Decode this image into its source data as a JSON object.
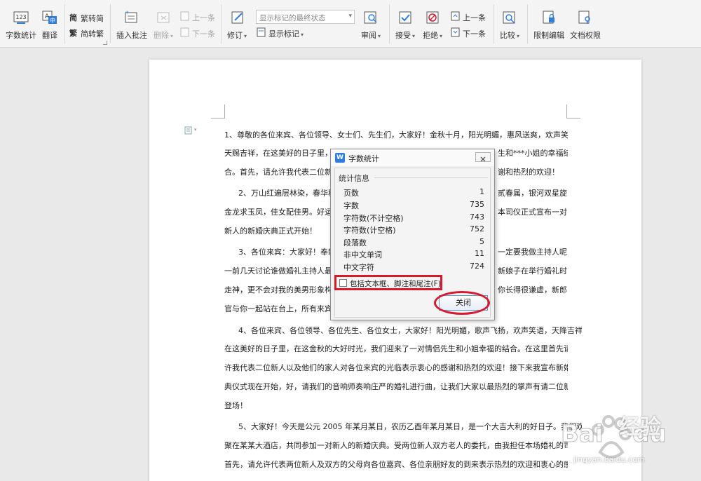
{
  "ribbon": {
    "word_count_label": "字数统计",
    "translate_label": "翻译",
    "trad_to_simp_label": "繁转简",
    "simp_to_trad_label": "简转繁",
    "insert_comment_label": "插入批注",
    "delete_label": "删除",
    "prev_comment_label": "上一条",
    "next_comment_label": "下一条",
    "revise_label": "修订",
    "markup_state_value": "显示标记的最终状态",
    "show_markup_label": "显示标记",
    "review_label": "审阅",
    "accept_label": "接受",
    "reject_label": "拒绝",
    "prev_change_label": "上一条",
    "next_change_label": "下一条",
    "compare_label": "比较",
    "restrict_edit_label": "限制编辑",
    "doc_rights_label": "文档权限"
  },
  "document": {
    "lines": [
      "1、尊敬的各位来宾、各位领导、女士们、先生们，大家好！金秋十月，阳光明媚，惠风送爽，欢声笑语，",
      "天赐吉祥，在这美好的日子里，",
      "合。首先，请允许我代表二位新",
      "2、万山红遍层林染，春华秋",
      "金龙求玉凤，佳女配佳男。好运",
      "新人的新婚庆典正式开始！",
      "3、各位来宾：大家好！奉新",
      "一前几天讨论谁做婚礼主持人最",
      "走神，更不会对我的美男形象构",
      "官与你一起站在台上，所有来宾",
      "4、各位来宾、各位领导、各位先生、各位女士，大家好！阳光明媚，歌声飞扬，欢声笑语，天降吉祥，",
      "在这美好的日子里，在这金秋的大好时光，我们迎来了一对情侣先生和小姐幸福的结合。在这里首先请允",
      "许我代表二位新人以及他们的家人对各位来宾的光临表示衷心的感谢和热烈的欢迎！接下来我宣布新婚庆",
      "典仪式现在开始，好，请我们的音响师奏响庄严的婚礼进行曲，让我们大家以最热烈的掌声有请二位新人",
      "登场！",
      "5、大家好！今天是公元 2005 年某月某日，农历乙酉年某月某日，是一个大吉大利的好日子。我们欢",
      "聚在某某大酒店，共同参加一对新人的新婚庆典。受两位新人双方老人的委托，由我担任本场婚礼的司仪，",
      "首先，请允许代表两位新人及双方的父母向各位嘉宾、各位亲朋好友的到来表示热烈的欢迎和衷心的感谢！"
    ],
    "right_fragments": [
      "生和***小姐的幸福结",
      "谢和热烈的欢迎！",
      "贰春属，银河双星旋，",
      "本司仪正式宣布一对",
      "一定要我做主持人呢",
      "新娘子在举行婚礼时",
      "你长得很谦虚，新郎"
    ]
  },
  "dialog": {
    "title": "字数统计",
    "section_title": "统计信息",
    "stats": [
      {
        "label": "页数",
        "value": "1"
      },
      {
        "label": "字数",
        "value": "735"
      },
      {
        "label": "字符数(不计空格)",
        "value": "743"
      },
      {
        "label": "字符数(计空格)",
        "value": "752"
      },
      {
        "label": "段落数",
        "value": "5"
      },
      {
        "label": "非中文单词",
        "value": "11"
      },
      {
        "label": "中文字符",
        "value": "724"
      }
    ],
    "include_label": "包括文本框、脚注和尾注(F)",
    "close_label": "关闭"
  },
  "colors": {
    "highlight_red": "#d8192c",
    "wps_blue": "#2f7de1"
  }
}
